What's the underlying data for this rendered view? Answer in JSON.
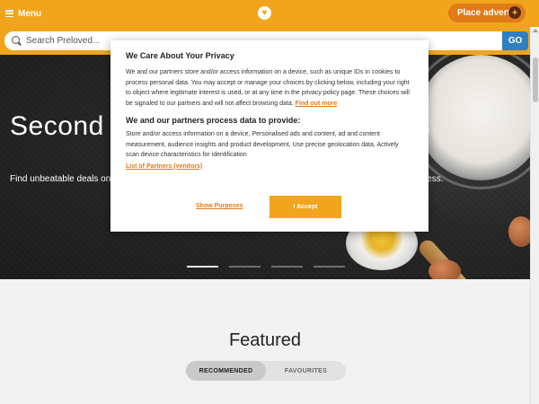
{
  "header": {
    "menu_label": "Menu",
    "logo_icon": "heart-logo-icon",
    "place_advert_label": "Place advert",
    "place_advert_icon": "pin-icon",
    "brand_color": "#f0a51c"
  },
  "search": {
    "placeholder": "Search Preloved...",
    "go_label": "GO"
  },
  "hero": {
    "title": "Second hand Bakeware for Bakes",
    "subtitle": "Find unbeatable deals on baking equipment and bake the perfect sweet treats and cakes every time, for less.",
    "slides_count": 4,
    "active_slide": 1
  },
  "featured": {
    "title": "Featured",
    "tabs": [
      "RECOMMENDED",
      "FAVOURITES"
    ],
    "active_tab": "RECOMMENDED"
  },
  "consent": {
    "title": "We Care About Your Privacy",
    "body": "We and our partners store and/or access information on a device, such as unique IDs in cookies to process personal data. You may accept or manage your choices by clicking below, including your right to object where legitimate interest is used, or at any time in the privacy policy page. These choices will be signaled to our partners and will not affect browsing data.",
    "find_out_more": "Find out more",
    "subtitle": "We and our partners process data to provide:",
    "purposes": "Store and/or access information on a device, Personalised ads and content, ad and content measurement, audience insights and product development, Use precise geolocation data, Actively scan device characteristics for identification",
    "partners_link": "List of Partners (vendors)",
    "show_purposes": "Show Purposes",
    "accept": "I Accept"
  }
}
